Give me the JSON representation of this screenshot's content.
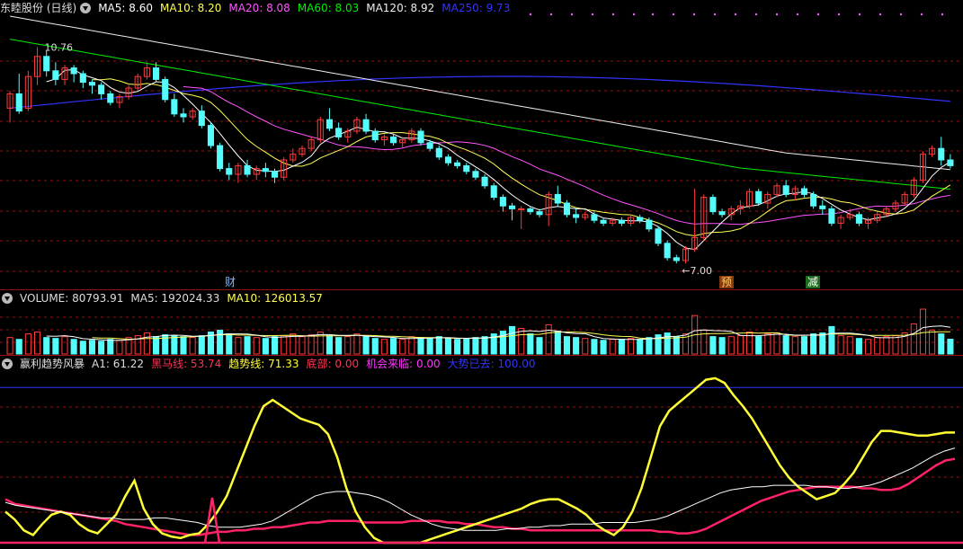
{
  "header": {
    "stock_title": "东睦股份 (日线)",
    "ma5": "MA5: 8.60",
    "ma10": "MA10: 8.20",
    "ma20": "MA20: 8.08",
    "ma60": "MA60: 8.03",
    "ma120": "MA120: 8.92",
    "ma250": "MA250: 9.73"
  },
  "volume_header": {
    "volume": "VOLUME: 80793.91",
    "ma5": "MA5: 192024.33",
    "ma10": "MA10: 126013.57"
  },
  "indicator_header": {
    "name": "赢利趋势风暴",
    "a1": "A1: 61.22",
    "heima": "黑马线: 53.74",
    "trend": "趋势线: 71.33",
    "bottom": "底部: 0.00",
    "chance": "机会来临: 0.00",
    "gain": "大势已去: 100.00"
  },
  "annotations": {
    "high_label": "10.76",
    "low_label": "7.00",
    "marker_cai": "财",
    "marker_yu": "预",
    "marker_jian": "减"
  },
  "colors": {
    "up": "#ff3b3b",
    "down": "#54fcfc",
    "ma5": "#ffffff",
    "ma10": "#ffff55",
    "ma20": "#ff55ff",
    "ma60": "#00ee00",
    "ma120": "#eeeeee",
    "ma250": "#3333ff",
    "grid": "#9a1010"
  },
  "chart_data": [
    {
      "type": "candlestick",
      "title": "东睦股份 (日线)",
      "ylim": [
        6.8,
        11.3
      ],
      "candles": [
        [
          9.7,
          10.0,
          9.45,
          9.95
        ],
        [
          9.95,
          10.3,
          9.6,
          9.65
        ],
        [
          9.7,
          10.35,
          9.65,
          10.25
        ],
        [
          10.25,
          10.76,
          10.1,
          10.6
        ],
        [
          10.6,
          10.7,
          10.25,
          10.35
        ],
        [
          10.35,
          10.5,
          10.1,
          10.2
        ],
        [
          10.2,
          10.45,
          10.1,
          10.4
        ],
        [
          10.4,
          10.45,
          10.15,
          10.3
        ],
        [
          10.3,
          10.35,
          10.05,
          10.15
        ],
        [
          10.15,
          10.2,
          9.95,
          10.1
        ],
        [
          10.1,
          10.15,
          9.85,
          9.95
        ],
        [
          9.95,
          10.0,
          9.75,
          9.8
        ],
        [
          9.8,
          9.95,
          9.7,
          9.9
        ],
        [
          9.9,
          10.1,
          9.85,
          10.05
        ],
        [
          10.05,
          10.3,
          10.0,
          10.25
        ],
        [
          10.25,
          10.5,
          10.2,
          10.4
        ],
        [
          10.4,
          10.5,
          10.15,
          10.2
        ],
        [
          10.2,
          10.25,
          9.8,
          9.85
        ],
        [
          9.85,
          9.95,
          9.55,
          9.6
        ],
        [
          9.6,
          9.7,
          9.45,
          9.55
        ],
        [
          9.55,
          9.7,
          9.5,
          9.65
        ],
        [
          9.65,
          9.75,
          9.35,
          9.4
        ],
        [
          9.4,
          9.45,
          9.0,
          9.05
        ],
        [
          9.05,
          9.1,
          8.6,
          8.65
        ],
        [
          8.65,
          8.75,
          8.45,
          8.55
        ],
        [
          8.55,
          8.75,
          8.4,
          8.7
        ],
        [
          8.7,
          8.8,
          8.5,
          8.55
        ],
        [
          8.55,
          8.7,
          8.45,
          8.65
        ],
        [
          8.65,
          8.75,
          8.5,
          8.6
        ],
        [
          8.6,
          8.65,
          8.4,
          8.5
        ],
        [
          8.5,
          8.85,
          8.45,
          8.8
        ],
        [
          8.8,
          9.0,
          8.75,
          8.9
        ],
        [
          8.9,
          9.05,
          8.85,
          9.0
        ],
        [
          9.0,
          9.2,
          8.95,
          9.15
        ],
        [
          9.15,
          9.55,
          9.1,
          9.5
        ],
        [
          9.5,
          9.7,
          9.3,
          9.35
        ],
        [
          9.35,
          9.45,
          9.15,
          9.2
        ],
        [
          9.2,
          9.35,
          9.1,
          9.3
        ],
        [
          9.3,
          9.55,
          9.25,
          9.5
        ],
        [
          9.5,
          9.6,
          9.25,
          9.3
        ],
        [
          9.3,
          9.35,
          9.1,
          9.15
        ],
        [
          9.15,
          9.25,
          9.05,
          9.2
        ],
        [
          9.2,
          9.25,
          9.05,
          9.1
        ],
        [
          9.1,
          9.2,
          9.0,
          9.15
        ],
        [
          9.15,
          9.35,
          9.1,
          9.3
        ],
        [
          9.3,
          9.35,
          9.05,
          9.1
        ],
        [
          9.1,
          9.15,
          8.95,
          9.0
        ],
        [
          9.0,
          9.05,
          8.8,
          8.85
        ],
        [
          8.85,
          8.9,
          8.7,
          8.75
        ],
        [
          8.75,
          8.8,
          8.65,
          8.7
        ],
        [
          8.7,
          8.75,
          8.55,
          8.6
        ],
        [
          8.6,
          8.65,
          8.45,
          8.5
        ],
        [
          8.5,
          8.55,
          8.3,
          8.35
        ],
        [
          8.35,
          8.4,
          8.1,
          8.15
        ],
        [
          8.15,
          8.2,
          7.9,
          8.0
        ],
        [
          8.0,
          8.05,
          7.75,
          7.95
        ],
        [
          7.95,
          8.0,
          7.6,
          7.95
        ],
        [
          7.95,
          8.0,
          7.85,
          7.9
        ],
        [
          7.9,
          7.95,
          7.8,
          7.85
        ],
        [
          7.85,
          8.25,
          7.65,
          8.2
        ],
        [
          8.2,
          8.35,
          8.0,
          8.05
        ],
        [
          8.05,
          8.1,
          7.8,
          7.85
        ],
        [
          7.85,
          7.95,
          7.7,
          7.8
        ],
        [
          7.8,
          7.9,
          7.75,
          7.85
        ],
        [
          7.85,
          7.9,
          7.7,
          7.75
        ],
        [
          7.75,
          7.8,
          7.65,
          7.7
        ],
        [
          7.7,
          7.8,
          7.65,
          7.75
        ],
        [
          7.75,
          7.8,
          7.65,
          7.7
        ],
        [
          7.7,
          7.85,
          7.65,
          7.8
        ],
        [
          7.8,
          7.85,
          7.7,
          7.75
        ],
        [
          7.75,
          7.8,
          7.55,
          7.6
        ],
        [
          7.6,
          7.65,
          7.3,
          7.35
        ],
        [
          7.35,
          7.4,
          7.05,
          7.1
        ],
        [
          7.1,
          7.15,
          7.0,
          7.05
        ],
        [
          7.05,
          7.3,
          7.0,
          7.25
        ],
        [
          7.25,
          8.3,
          7.2,
          7.45
        ],
        [
          7.45,
          8.2,
          7.4,
          8.15
        ],
        [
          8.15,
          8.2,
          7.85,
          7.9
        ],
        [
          7.9,
          7.95,
          7.8,
          7.85
        ],
        [
          7.85,
          8.0,
          7.75,
          7.95
        ],
        [
          7.95,
          8.1,
          7.85,
          8.0
        ],
        [
          8.0,
          8.3,
          7.95,
          8.25
        ],
        [
          8.25,
          8.3,
          8.0,
          8.05
        ],
        [
          8.05,
          8.25,
          7.95,
          8.2
        ],
        [
          8.2,
          8.4,
          8.15,
          8.35
        ],
        [
          8.35,
          8.45,
          8.15,
          8.2
        ],
        [
          8.2,
          8.35,
          8.1,
          8.3
        ],
        [
          8.3,
          8.35,
          8.15,
          8.2
        ],
        [
          8.2,
          8.25,
          7.95,
          8.0
        ],
        [
          8.0,
          8.1,
          7.85,
          7.95
        ],
        [
          7.95,
          8.0,
          7.65,
          7.7
        ],
        [
          7.7,
          7.85,
          7.6,
          7.8
        ],
        [
          7.8,
          7.95,
          7.75,
          7.85
        ],
        [
          7.85,
          7.9,
          7.65,
          7.7
        ],
        [
          7.7,
          7.8,
          7.6,
          7.75
        ],
        [
          7.75,
          7.9,
          7.7,
          7.85
        ],
        [
          7.85,
          8.0,
          7.8,
          7.95
        ],
        [
          7.95,
          8.1,
          7.9,
          8.05
        ],
        [
          8.05,
          8.25,
          8.0,
          8.2
        ],
        [
          8.2,
          8.5,
          8.15,
          8.45
        ],
        [
          8.45,
          8.95,
          8.4,
          8.9
        ],
        [
          8.9,
          9.05,
          8.85,
          9.0
        ],
        [
          9.0,
          9.2,
          8.7,
          8.8
        ],
        [
          8.8,
          8.9,
          8.65,
          8.7
        ]
      ]
    },
    {
      "type": "bar",
      "title": "VOLUME",
      "ylim": [
        0,
        260000
      ],
      "values": [
        90000,
        80000,
        110000,
        120000,
        90000,
        85000,
        95000,
        80000,
        70000,
        75000,
        70000,
        80000,
        75000,
        90000,
        100000,
        115000,
        95000,
        105000,
        100000,
        95000,
        90000,
        100000,
        120000,
        130000,
        110000,
        90000,
        95000,
        90000,
        85000,
        95000,
        100000,
        110000,
        95000,
        105000,
        120000,
        100000,
        90000,
        95000,
        110000,
        95000,
        85000,
        80000,
        85000,
        80000,
        95000,
        90000,
        85000,
        95000,
        85000,
        80000,
        85000,
        90000,
        95000,
        110000,
        125000,
        150000,
        140000,
        110000,
        90000,
        160000,
        125000,
        95000,
        90000,
        85000,
        80000,
        75000,
        80000,
        80000,
        85000,
        80000,
        90000,
        105000,
        115000,
        95000,
        110000,
        210000,
        130000,
        95000,
        90000,
        95000,
        100000,
        120000,
        95000,
        110000,
        115000,
        100000,
        95000,
        95000,
        110000,
        115000,
        150000,
        100000,
        95000,
        85000,
        80000,
        90000,
        95000,
        100000,
        115000,
        165000,
        245000,
        130000,
        110000,
        80794
      ]
    },
    {
      "type": "line",
      "title": "赢利趋势风暴",
      "ylim": [
        0,
        110
      ],
      "series": [
        {
          "name": "黑马线",
          "values": [
            28,
            25,
            24,
            23,
            22,
            21,
            20,
            19,
            18,
            17,
            16,
            15,
            14,
            12,
            11,
            10,
            9,
            8,
            7,
            6,
            5,
            5,
            6,
            7,
            7,
            8,
            8,
            9,
            9,
            10,
            10,
            11,
            12,
            13,
            13,
            14,
            14,
            14,
            14,
            13,
            13,
            13,
            13,
            13,
            14,
            14,
            14,
            14,
            13,
            13,
            12,
            12,
            11,
            10,
            10,
            9,
            9,
            8,
            8,
            8,
            8,
            8,
            8,
            8,
            8,
            8,
            8,
            8,
            8,
            8,
            8,
            7,
            7,
            6,
            6,
            7,
            9,
            12,
            15,
            18,
            21,
            24,
            27,
            29,
            31,
            33,
            34,
            35,
            36,
            36,
            36,
            36,
            36,
            35,
            35,
            34,
            34,
            35,
            38,
            42,
            46,
            50,
            53,
            54
          ]
        },
        {
          "name": "趋势线",
          "values": [
            20,
            15,
            8,
            5,
            12,
            18,
            20,
            18,
            12,
            8,
            6,
            12,
            18,
            30,
            40,
            22,
            12,
            6,
            4,
            3,
            5,
            6,
            12,
            20,
            30,
            45,
            60,
            75,
            88,
            92,
            88,
            84,
            80,
            78,
            76,
            70,
            55,
            35,
            20,
            10,
            3,
            0,
            0,
            0,
            0,
            0,
            2,
            4,
            6,
            8,
            10,
            12,
            14,
            16,
            18,
            20,
            22,
            25,
            27,
            28,
            28,
            25,
            22,
            18,
            12,
            8,
            5,
            10,
            20,
            35,
            55,
            75,
            85,
            90,
            95,
            100,
            105,
            106,
            103,
            95,
            88,
            80,
            70,
            60,
            50,
            42,
            36,
            32,
            28,
            30,
            32,
            38,
            45,
            55,
            65,
            72,
            72,
            71,
            70,
            69,
            69,
            70,
            71,
            71
          ]
        },
        {
          "name": "A1",
          "values": [
            26,
            24,
            23,
            22,
            21,
            20,
            19,
            18,
            17,
            16,
            16,
            15,
            15,
            15,
            16,
            16,
            15,
            14,
            13,
            11,
            10,
            10,
            10,
            11,
            12,
            14,
            18,
            22,
            26,
            30,
            32,
            33,
            33,
            32,
            31,
            29,
            26,
            22,
            18,
            15,
            12,
            10,
            9,
            8,
            8,
            8,
            8,
            9,
            9,
            10,
            10,
            11,
            11,
            12,
            12,
            12,
            13,
            13,
            13,
            13,
            14,
            15,
            17,
            20,
            23,
            26,
            29,
            32,
            34,
            35,
            36,
            36,
            37,
            37,
            37,
            37,
            36,
            36,
            35,
            35,
            36,
            37,
            39,
            42,
            45,
            48,
            52,
            56,
            59,
            61
          ]
        }
      ]
    }
  ]
}
